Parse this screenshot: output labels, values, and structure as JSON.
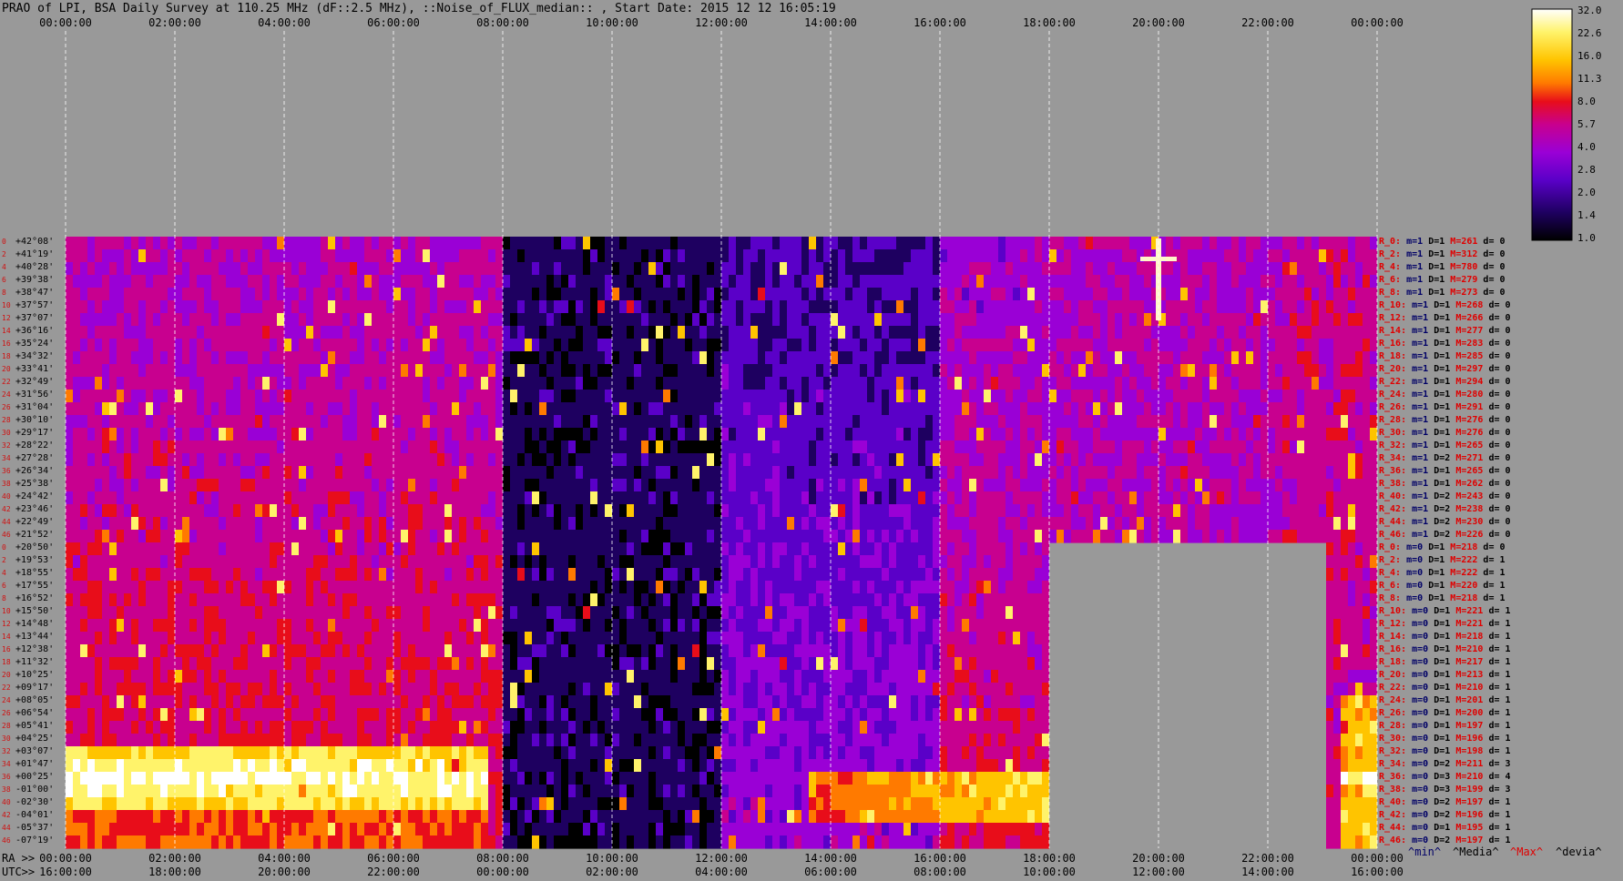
{
  "header": {
    "title": "PRAO of LPI, BSA Daily Survey at 110.25 MHz (dF::2.5 MHz), ::Noise_of_FLUX_median:: , Start Date: 2015 12 12 16:05:19"
  },
  "colorbar": {
    "ticks": [
      "32.0",
      "22.6",
      "16.0",
      "11.3",
      "8.0",
      "5.7",
      "4.0",
      "2.8",
      "2.0",
      "1.4",
      "1.0"
    ],
    "colors": [
      "#ffffff",
      "#fff36a",
      "#ffc400",
      "#ff7a00",
      "#e80d1a",
      "#c8008f",
      "#9a00d6",
      "#5a00c8",
      "#1e0060",
      "#000000"
    ]
  },
  "chart_data": {
    "type": "heatmap",
    "title": "PRAO of LPI, BSA Daily Survey at 110.25 MHz (dF::2.5 MHz), ::Noise_of_FLUX_median:: , Start Date: 2015 12 12 16:05:19",
    "x_top_labels": [
      "00:00:00",
      "02:00:00",
      "04:00:00",
      "06:00:00",
      "08:00:00",
      "10:00:00",
      "12:00:00",
      "14:00:00",
      "16:00:00",
      "18:00:00",
      "20:00:00",
      "22:00:00",
      "00:00:00"
    ],
    "x_bottom_ra_labels": [
      "00:00:00",
      "02:00:00",
      "04:00:00",
      "06:00:00",
      "08:00:00",
      "10:00:00",
      "12:00:00",
      "14:00:00",
      "16:00:00",
      "18:00:00",
      "20:00:00",
      "22:00:00",
      "00:00:00"
    ],
    "x_bottom_utc_labels": [
      "16:00:00",
      "18:00:00",
      "20:00:00",
      "22:00:00",
      "00:00:00",
      "02:00:00",
      "04:00:00",
      "06:00:00",
      "08:00:00",
      "10:00:00",
      "12:00:00",
      "14:00:00",
      "16:00:00"
    ],
    "ra_axis_label": "RA >>",
    "utc_axis_label": "UTC>>",
    "declinations": [
      "+42°08'",
      "+41°19'",
      "+40°28'",
      "+39°38'",
      "+38°47'",
      "+37°57'",
      "+37°07'",
      "+36°16'",
      "+35°24'",
      "+34°32'",
      "+33°41'",
      "+32°49'",
      "+31°56'",
      "+31°04'",
      "+30°10'",
      "+29°17'",
      "+28°22'",
      "+27°28'",
      "+26°34'",
      "+25°38'",
      "+24°42'",
      "+23°46'",
      "+22°49'",
      "+21°52'",
      "+20°50'",
      "+19°53'",
      "+18°55'",
      "+17°55'",
      "+16°52'",
      "+15°50'",
      "+14°48'",
      "+13°44'",
      "+12°38'",
      "+11°32'",
      "+10°25'",
      "+09°17'",
      "+08°05'",
      "+06°54'",
      "+05°41'",
      "+04°25'",
      "+03°07'",
      "+01°47'",
      "+00°25'",
      "-01°00'",
      "-02°30'",
      "-04°01'",
      "-05°37'",
      "-07°19'"
    ],
    "row_numbers": [
      "0",
      "2",
      "4",
      "6",
      "8",
      "10",
      "12",
      "14",
      "16",
      "18",
      "20",
      "22",
      "24",
      "26",
      "28",
      "30",
      "32",
      "34",
      "36",
      "38",
      "40",
      "42",
      "44",
      "46",
      "0",
      "2",
      "4",
      "6",
      "8",
      "10",
      "12",
      "14",
      "16",
      "18",
      "20",
      "22",
      "24",
      "26",
      "28",
      "30",
      "32",
      "34",
      "36",
      "38",
      "40",
      "42",
      "44",
      "46"
    ],
    "row_stats": [
      {
        "r": "R_0:",
        "m": "m=1",
        "D": "D=1",
        "M": "M=261",
        "d": "d= 0"
      },
      {
        "r": "R_2:",
        "m": "m=1",
        "D": "D=1",
        "M": "M=312",
        "d": "d= 0"
      },
      {
        "r": "R_4:",
        "m": "m=1",
        "D": "D=1",
        "M": "M=780",
        "d": "d= 0"
      },
      {
        "r": "R_6:",
        "m": "m=1",
        "D": "D=1",
        "M": "M=279",
        "d": "d= 0"
      },
      {
        "r": "R_8:",
        "m": "m=1",
        "D": "D=1",
        "M": "M=273",
        "d": "d= 0"
      },
      {
        "r": "R_10:",
        "m": "m=1",
        "D": "D=1",
        "M": "M=268",
        "d": "d= 0"
      },
      {
        "r": "R_12:",
        "m": "m=1",
        "D": "D=1",
        "M": "M=266",
        "d": "d= 0"
      },
      {
        "r": "R_14:",
        "m": "m=1",
        "D": "D=1",
        "M": "M=277",
        "d": "d= 0"
      },
      {
        "r": "R_16:",
        "m": "m=1",
        "D": "D=1",
        "M": "M=283",
        "d": "d= 0"
      },
      {
        "r": "R_18:",
        "m": "m=1",
        "D": "D=1",
        "M": "M=285",
        "d": "d= 0"
      },
      {
        "r": "R_20:",
        "m": "m=1",
        "D": "D=1",
        "M": "M=297",
        "d": "d= 0"
      },
      {
        "r": "R_22:",
        "m": "m=1",
        "D": "D=1",
        "M": "M=294",
        "d": "d= 0"
      },
      {
        "r": "R_24:",
        "m": "m=1",
        "D": "D=1",
        "M": "M=280",
        "d": "d= 0"
      },
      {
        "r": "R_26:",
        "m": "m=1",
        "D": "D=1",
        "M": "M=291",
        "d": "d= 0"
      },
      {
        "r": "R_28:",
        "m": "m=1",
        "D": "D=1",
        "M": "M=276",
        "d": "d= 0"
      },
      {
        "r": "R_30:",
        "m": "m=1",
        "D": "D=1",
        "M": "M=276",
        "d": "d= 0"
      },
      {
        "r": "R_32:",
        "m": "m=1",
        "D": "D=1",
        "M": "M=265",
        "d": "d= 0"
      },
      {
        "r": "R_34:",
        "m": "m=1",
        "D": "D=2",
        "M": "M=271",
        "d": "d= 0"
      },
      {
        "r": "R_36:",
        "m": "m=1",
        "D": "D=1",
        "M": "M=265",
        "d": "d= 0"
      },
      {
        "r": "R_38:",
        "m": "m=1",
        "D": "D=1",
        "M": "M=262",
        "d": "d= 0"
      },
      {
        "r": "R_40:",
        "m": "m=1",
        "D": "D=2",
        "M": "M=243",
        "d": "d= 0"
      },
      {
        "r": "R_42:",
        "m": "m=1",
        "D": "D=2",
        "M": "M=238",
        "d": "d= 0"
      },
      {
        "r": "R_44:",
        "m": "m=1",
        "D": "D=2",
        "M": "M=230",
        "d": "d= 0"
      },
      {
        "r": "R_46:",
        "m": "m=1",
        "D": "D=2",
        "M": "M=226",
        "d": "d= 0"
      },
      {
        "r": "R_0:",
        "m": "m=0",
        "D": "D=1",
        "M": "M=218",
        "d": "d= 0"
      },
      {
        "r": "R_2:",
        "m": "m=0",
        "D": "D=1",
        "M": "M=222",
        "d": "d= 1"
      },
      {
        "r": "R_4:",
        "m": "m=0",
        "D": "D=1",
        "M": "M=222",
        "d": "d= 1"
      },
      {
        "r": "R_6:",
        "m": "m=0",
        "D": "D=1",
        "M": "M=220",
        "d": "d= 1"
      },
      {
        "r": "R_8:",
        "m": "m=0",
        "D": "D=1",
        "M": "M=218",
        "d": "d= 1"
      },
      {
        "r": "R_10:",
        "m": "m=0",
        "D": "D=1",
        "M": "M=221",
        "d": "d= 1"
      },
      {
        "r": "R_12:",
        "m": "m=0",
        "D": "D=1",
        "M": "M=221",
        "d": "d= 1"
      },
      {
        "r": "R_14:",
        "m": "m=0",
        "D": "D=1",
        "M": "M=218",
        "d": "d= 1"
      },
      {
        "r": "R_16:",
        "m": "m=0",
        "D": "D=1",
        "M": "M=210",
        "d": "d= 1"
      },
      {
        "r": "R_18:",
        "m": "m=0",
        "D": "D=1",
        "M": "M=217",
        "d": "d= 1"
      },
      {
        "r": "R_20:",
        "m": "m=0",
        "D": "D=1",
        "M": "M=213",
        "d": "d= 1"
      },
      {
        "r": "R_22:",
        "m": "m=0",
        "D": "D=1",
        "M": "M=210",
        "d": "d= 1"
      },
      {
        "r": "R_24:",
        "m": "m=0",
        "D": "D=1",
        "M": "M=201",
        "d": "d= 1"
      },
      {
        "r": "R_26:",
        "m": "m=0",
        "D": "D=1",
        "M": "M=200",
        "d": "d= 1"
      },
      {
        "r": "R_28:",
        "m": "m=0",
        "D": "D=1",
        "M": "M=197",
        "d": "d= 1"
      },
      {
        "r": "R_30:",
        "m": "m=0",
        "D": "D=1",
        "M": "M=196",
        "d": "d= 1"
      },
      {
        "r": "R_32:",
        "m": "m=0",
        "D": "D=1",
        "M": "M=198",
        "d": "d= 1"
      },
      {
        "r": "R_34:",
        "m": "m=0",
        "D": "D=2",
        "M": "M=211",
        "d": "d= 3"
      },
      {
        "r": "R_36:",
        "m": "m=0",
        "D": "D=3",
        "M": "M=210",
        "d": "d= 4"
      },
      {
        "r": "R_38:",
        "m": "m=0",
        "D": "D=3",
        "M": "M=199",
        "d": "d= 3"
      },
      {
        "r": "R_40:",
        "m": "m=0",
        "D": "D=2",
        "M": "M=197",
        "d": "d= 1"
      },
      {
        "r": "R_42:",
        "m": "m=0",
        "D": "D=2",
        "M": "M=196",
        "d": "d= 1"
      },
      {
        "r": "R_44:",
        "m": "m=0",
        "D": "D=1",
        "M": "M=195",
        "d": "d= 1"
      },
      {
        "r": "R_46:",
        "m": "m=0",
        "D": "D=2",
        "M": "M=197",
        "d": "d= 1"
      }
    ],
    "stat_legend": [
      "^min^",
      "^Media^",
      "^Max^",
      "^devia^"
    ],
    "colorbar_range": [
      1.0,
      32.0
    ],
    "colorbar_scale": "log"
  }
}
